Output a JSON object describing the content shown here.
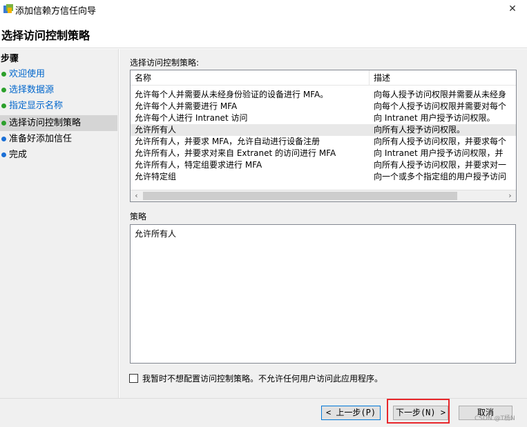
{
  "window": {
    "title": "添加信赖方信任向导",
    "close_glyph": "✕"
  },
  "header": {
    "title": "选择访问控制策略"
  },
  "sidebar": {
    "steps_label": "步骤",
    "steps": [
      {
        "label": "欢迎使用",
        "state": "done"
      },
      {
        "label": "选择数据源",
        "state": "done"
      },
      {
        "label": "指定显示名称",
        "state": "done"
      },
      {
        "label": "选择访问控制策略",
        "state": "current"
      },
      {
        "label": "准备好添加信任",
        "state": "pending"
      },
      {
        "label": "完成",
        "state": "pending"
      }
    ]
  },
  "main": {
    "list_label": "选择访问控制策略:",
    "columns": [
      "名称",
      "描述"
    ],
    "rows": [
      {
        "name": "允许每个人并需要从未经身份验证的设备进行 MFA。",
        "desc": "向每人授予访问权限并需要从未经身"
      },
      {
        "name": "允许每个人并需要进行 MFA",
        "desc": "向每个人授予访问权限并需要对每个"
      },
      {
        "name": "允许每个人进行 Intranet 访问",
        "desc": "向 Intranet 用户授予访问权限。"
      },
      {
        "name": "允许所有人",
        "desc": "向所有人授予访问权限。"
      },
      {
        "name": "允许所有人，并要求 MFA，允许自动进行设备注册",
        "desc": "向所有人授予访问权限，并要求每个"
      },
      {
        "name": "允许所有人，并要求对来自 Extranet 的访问进行 MFA",
        "desc": "向 Intranet 用户授予访问权限，并"
      },
      {
        "name": "允许所有人，特定组要求进行 MFA",
        "desc": "向所有人授予访问权限，并要求对一"
      },
      {
        "name": "允许特定组",
        "desc": "向一个或多个指定组的用户授予访问"
      }
    ],
    "selected_index": 3,
    "policy_label": "策略",
    "policy_text": "允许所有人",
    "checkbox_label": "我暂时不想配置访问控制策略。不允许任何用户访问此应用程序。",
    "checkbox_checked": false
  },
  "buttons": {
    "back": "< 上一步(P)",
    "next": "下一步(N) >",
    "cancel": "取消"
  },
  "watermark": "CSDN @T杨N",
  "colors": {
    "accent": "#0078d7",
    "highlight": "#e8262a",
    "done_dot": "#2ca02c",
    "pending_dot": "#1a6fd6",
    "link": "#0066cc"
  }
}
